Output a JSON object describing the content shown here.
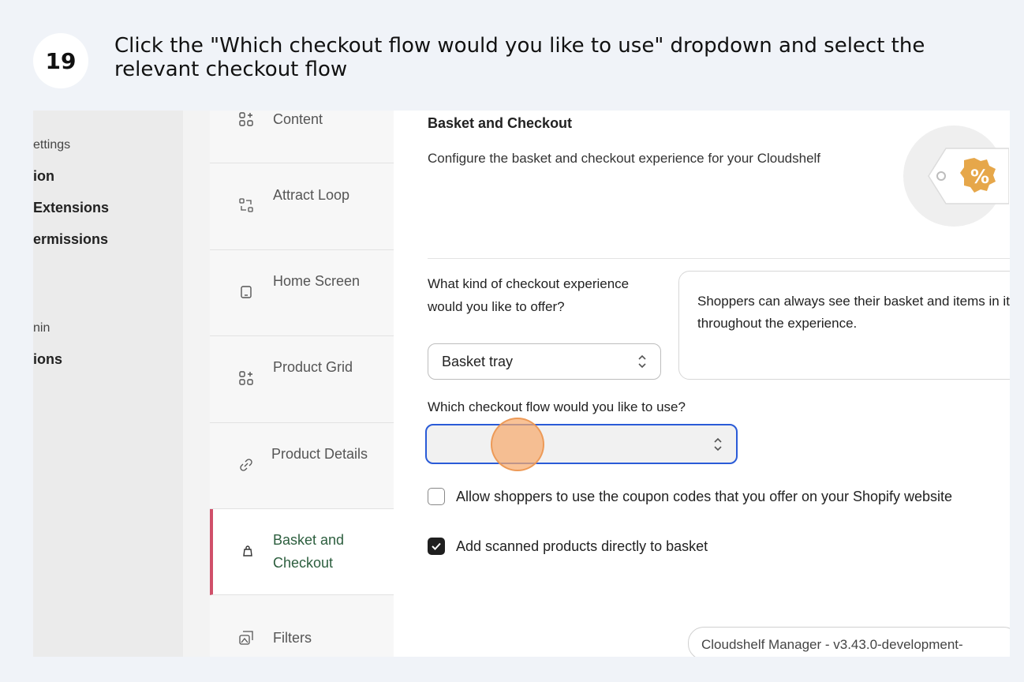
{
  "step": {
    "number": "19",
    "instruction": "Click the \"Which checkout flow would you like to use\" dropdown and select the relevant checkout flow"
  },
  "left_nav": {
    "items": [
      {
        "label": "ettings",
        "style": "sub"
      },
      {
        "label": "ion",
        "style": "bold"
      },
      {
        "label": "Extensions",
        "style": "bold"
      },
      {
        "label": "ermissions",
        "style": "bold"
      },
      {
        "label": "nin",
        "style": "sub"
      },
      {
        "label": "ions",
        "style": "bold"
      }
    ]
  },
  "sections": [
    {
      "label": "Content",
      "icon": "grid-plus-icon",
      "active": false
    },
    {
      "label": "Attract Loop",
      "icon": "loop-icon",
      "active": false
    },
    {
      "label": "Home Screen",
      "icon": "tablet-icon",
      "active": false
    },
    {
      "label": "Product Grid",
      "icon": "grid-plus-icon",
      "active": false
    },
    {
      "label": "Product Details",
      "icon": "link-icon",
      "active": false
    },
    {
      "label": "Basket and Checkout",
      "icon": "bag-icon",
      "active": true
    },
    {
      "label": "Filters",
      "icon": "filter-icon",
      "active": false
    }
  ],
  "main": {
    "title": "Basket and Checkout",
    "description": "Configure the basket and checkout experience for your Cloudshelf",
    "experience_question": "What kind of checkout experience would you like to offer?",
    "experience_value": "Basket tray",
    "experience_info": "Shoppers can always see their basket and items in it throughout the experience.",
    "flow_question": "Which checkout flow would you like to use?",
    "flow_value": "",
    "coupon_label": "Allow shoppers to use the coupon codes that you offer on your Shopify website",
    "coupon_checked": false,
    "scan_label": "Add scanned products directly to basket",
    "scan_checked": true,
    "version": "Cloudshelf Manager - v3.43.0-development-"
  },
  "colors": {
    "background": "#f0f3f8",
    "active_accent": "#d0506a",
    "active_text": "#2c5e3e",
    "focus_border": "#2a5bd7",
    "click_marker": "#f7aa6e"
  }
}
